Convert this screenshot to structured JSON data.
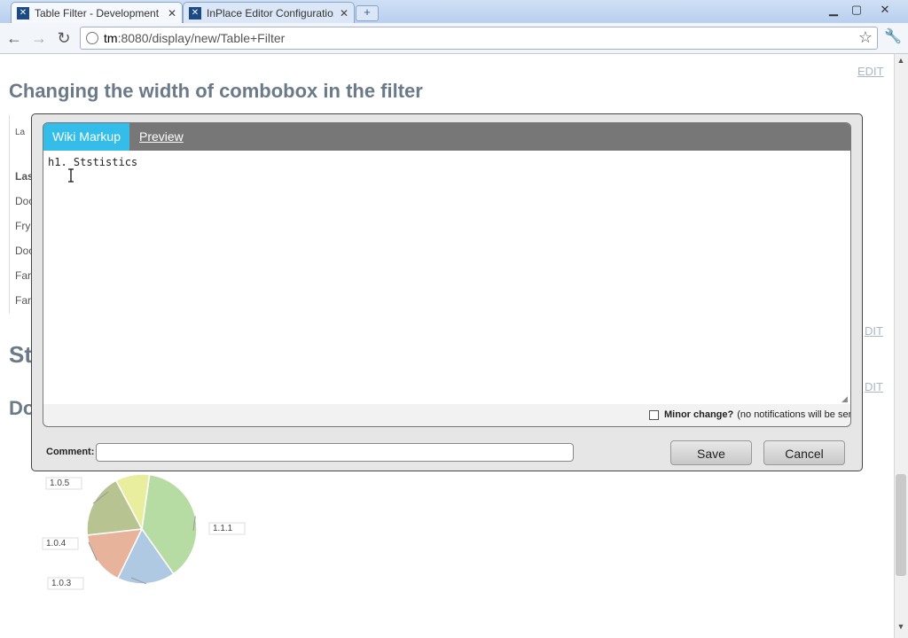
{
  "browser": {
    "tabs": [
      {
        "title": "Table Filter - Development ...",
        "active": true
      },
      {
        "title": "InPlace Editor Configuratio...",
        "active": false
      }
    ],
    "url_host": "tm",
    "url_path": ":8080/display/new/Table+Filter"
  },
  "page": {
    "title": "Changing the width of combobox in the filter",
    "edit_label": "EDIT",
    "bg_table_header_1": "La",
    "bg_table_header_2": "Las",
    "bg_table_rows": [
      "Doc",
      "Fry",
      "Doc",
      "Far",
      "Far"
    ],
    "bg_heading_2": "St",
    "bg_heading_3": "Do"
  },
  "editor": {
    "tabs": {
      "wiki": "Wiki Markup",
      "preview": "Preview"
    },
    "markup_text": "h1. Ststistics",
    "minor_change_label": "Minor change?",
    "minor_change_note": "(no notifications will be sent)",
    "comment_label": "Comment:",
    "comment_value": "",
    "save_label": "Save",
    "cancel_label": "Cancel"
  },
  "chart_data": {
    "type": "pie",
    "labels": [
      "1.1.1",
      "1.0.3",
      "1.0.4",
      "1.0.5",
      ""
    ],
    "values": [
      38,
      17,
      16,
      19,
      10
    ],
    "colors": [
      "#b7dca3",
      "#b0c9e2",
      "#e7b39a",
      "#b8c392",
      "#e8ee9e"
    ]
  }
}
